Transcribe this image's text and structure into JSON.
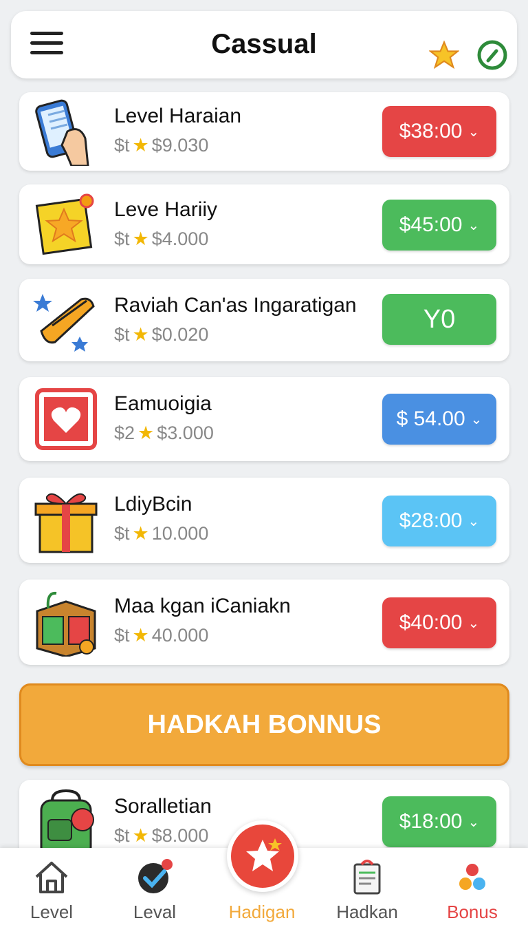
{
  "header": {
    "title": "Cassual"
  },
  "rows": [
    {
      "name": "Level Haraian",
      "sub_prefix": "$t",
      "sub_value": "$9.030",
      "price": "$38:00",
      "chevron": "⌄",
      "color": "#e54545",
      "icon": "phone-hand-icon"
    },
    {
      "name": "Leve Hariiy",
      "sub_prefix": "$t",
      "sub_value": "$4.000",
      "price": "$45:00",
      "chevron": "⌄",
      "color": "#4cbb5c",
      "icon": "star-note-icon"
    },
    {
      "name": "Raviah Can'as Ingaratigan",
      "sub_prefix": "$t",
      "sub_value": "$0.020",
      "price": "Y0",
      "chevron": "",
      "color": "#4cbb5c",
      "icon": "ticket-icon"
    },
    {
      "name": "Eamuoigia",
      "sub_prefix": "$2",
      "sub_value": "$3.000",
      "price": "$ 54.00",
      "chevron": "⌄",
      "color": "#4a90e2",
      "icon": "heart-card-icon"
    },
    {
      "name": "LdiyBcin",
      "sub_prefix": "$t",
      "sub_value": "10.000",
      "price": "$28:00",
      "chevron": "⌄",
      "color": "#5bc4f5",
      "icon": "gift-icon"
    },
    {
      "name": "Maa kgan iCaniakn",
      "sub_prefix": "$t",
      "sub_value": "40.000",
      "price": "$40:00",
      "chevron": "⌄",
      "color": "#e54545",
      "icon": "box-icon"
    }
  ],
  "bonus_button": {
    "label": "HADKAH BONNUS"
  },
  "last_row": {
    "name": "Soralletian",
    "sub_prefix": "$t",
    "sub_value": "$8.000",
    "price": "$18:00",
    "chevron": "⌄",
    "color": "#4cbb5c",
    "icon": "backpack-icon"
  },
  "nav": [
    {
      "label": "Level",
      "color": "#555555",
      "icon": "house-icon"
    },
    {
      "label": "Leval",
      "color": "#555555",
      "icon": "check-icon"
    },
    {
      "label": "Hadigan",
      "color": "#f2a93b",
      "icon": "star-icon"
    },
    {
      "label": "Hadkan",
      "color": "#555555",
      "icon": "notebook-icon"
    },
    {
      "label": "Bonus",
      "color": "#e54545",
      "icon": "dots-icon"
    }
  ]
}
